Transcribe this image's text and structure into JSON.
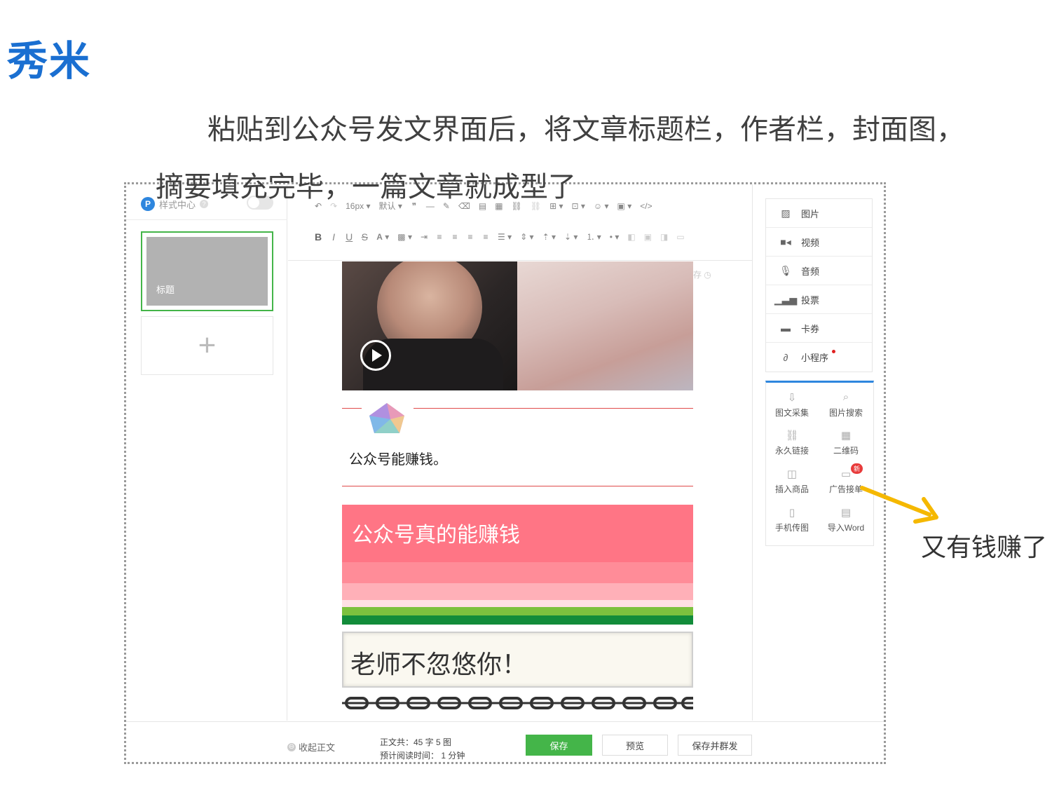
{
  "slide": {
    "title": "秀米",
    "caption_line1": "粘贴到公众号发文界面后，将文章标题栏，作者栏，封面图，",
    "caption_line2": "摘要填充完毕，一篇文章就成型了",
    "annotation": "又有钱赚了",
    "arrow_color": "#f5b800"
  },
  "left_panel": {
    "style_center_label": "样式中心",
    "logo_letter": "P",
    "help_mark": "?",
    "article_thumb_label": "标题",
    "add_symbol": "+"
  },
  "toolbar": {
    "font_size": "16px",
    "font_family": "默认",
    "bold": "B",
    "italic": "I",
    "underline": "U",
    "strike": "S",
    "font_color": "A",
    "code": "</>"
  },
  "editor": {
    "autosave_label": "自动保存",
    "line1": "公众号能赚钱。",
    "banner_text": "公众号真的能赚钱",
    "note_text": "老师不忽悠你！"
  },
  "media_menu": [
    {
      "label": "图片",
      "icon": "image-icon"
    },
    {
      "label": "视频",
      "icon": "video-icon"
    },
    {
      "label": "音频",
      "icon": "microphone-icon"
    },
    {
      "label": "投票",
      "icon": "bar-chart-icon"
    },
    {
      "label": "卡券",
      "icon": "card-icon"
    },
    {
      "label": "小程序",
      "icon": "mini-program-icon"
    }
  ],
  "tools": [
    {
      "label": "图文采集",
      "icon": "download-icon"
    },
    {
      "label": "图片搜索",
      "icon": "search-icon"
    },
    {
      "label": "永久链接",
      "icon": "link-icon"
    },
    {
      "label": "二维码",
      "icon": "qrcode-icon"
    },
    {
      "label": "插入商品",
      "icon": "bag-icon"
    },
    {
      "label": "广告接单",
      "icon": "ad-icon",
      "badge": "新"
    },
    {
      "label": "手机传图",
      "icon": "phone-icon"
    },
    {
      "label": "导入Word",
      "icon": "word-icon"
    }
  ],
  "footer": {
    "collapse_label": "收起正文",
    "stats_line1": "正文共：45 字 5 图",
    "stats_line2": "预计阅读时间： 1 分钟",
    "save_label": "保存",
    "preview_label": "预览",
    "publish_label": "保存并群发"
  },
  "colors": {
    "title_blue": "#1a6fd1",
    "accent_green": "#44b549",
    "banner_pink": "#ff7585"
  }
}
